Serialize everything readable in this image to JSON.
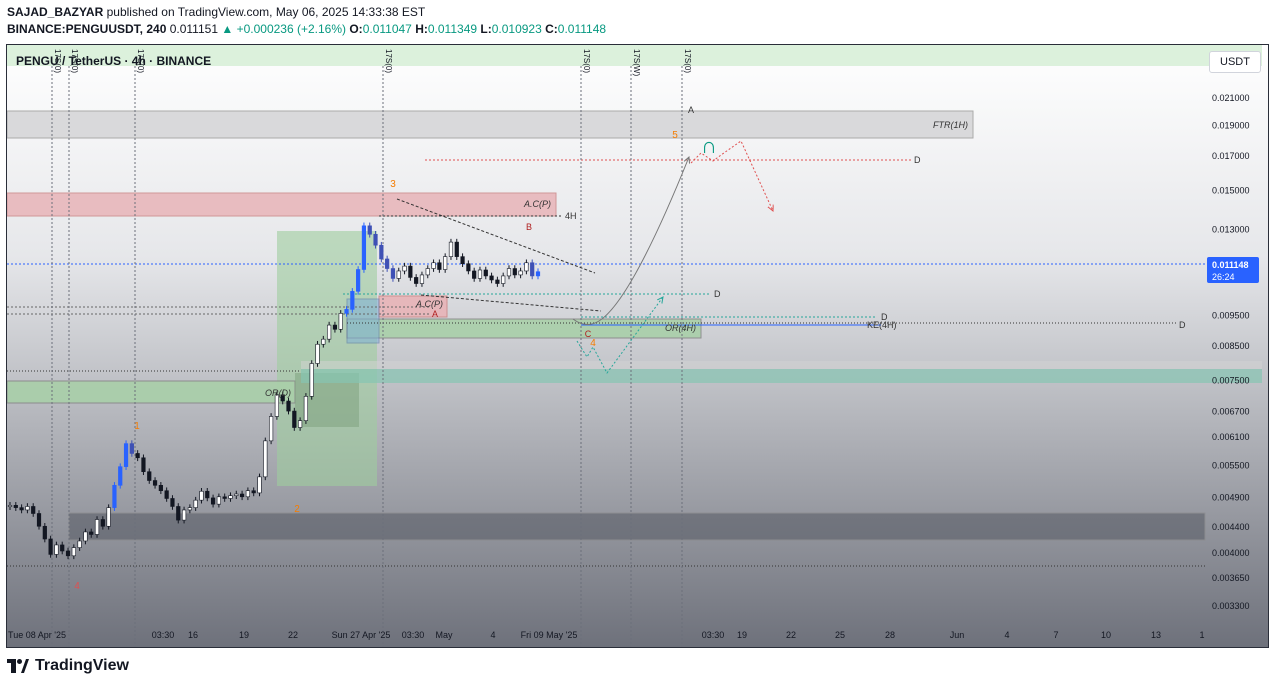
{
  "header": {
    "author": "SAJAD_BAZYAR",
    "published": "published on TradingView.com, May 06, 2025 14:33:38 EST",
    "symbol": "BINANCE:PENGUUSDT, 240",
    "last": "0.011151",
    "change": "+0.000236 (+2.16%)",
    "o_label": "O:",
    "o": "0.011047",
    "h_label": "H:",
    "h": "0.011349",
    "l_label": "L:",
    "l": "0.010923",
    "c_label": "C:",
    "c": "0.011148"
  },
  "legend_title": "PENGU / TetherUS · 4h · BINANCE",
  "currency_button": "USDT",
  "price_label": {
    "value": "0.011148",
    "countdown": "26:24"
  },
  "footer": {
    "brand": "TradingView"
  },
  "colors": {
    "accent": "#2962ff",
    "up": "#089981",
    "wave": "#f57c00"
  },
  "chart_data": {
    "type": "candlestick",
    "yscale": "log",
    "ylim": [
      0.0031,
      0.023
    ],
    "y_ticks": [
      "0.021000",
      "0.019000",
      "0.017000",
      "0.015000",
      "0.013000",
      "0.011500",
      "0.009500",
      "0.008500",
      "0.007500",
      "0.006700",
      "0.006100",
      "0.005500",
      "0.004900",
      "0.004400",
      "0.004000",
      "0.003650",
      "0.003300"
    ],
    "x_ticks": [
      "Tue 08 Apr '25",
      "03:30",
      "16",
      "19",
      "22",
      "Sun 27 Apr '25",
      "03:30",
      "May",
      "4",
      "Fri 09 May '25",
      "03:30",
      "19",
      "22",
      "25",
      "28",
      "Jun",
      "4",
      "7",
      "10",
      "13",
      "1"
    ],
    "vertical_labels": [
      "17S(0)",
      "17S(0)",
      "17S(0)",
      "17S(0)",
      "17S(0)",
      "17S(W)",
      "17S(0)"
    ],
    "zone_labels": [
      "FTR(1H)",
      "A.C(P)",
      "A.C(P)",
      "OR(4H)",
      "OR(D)",
      "KE(4H)"
    ],
    "level_labels": [
      "4H",
      "D",
      "D",
      "D",
      "D"
    ],
    "wave_labels": [
      "1",
      "2",
      "3",
      "4",
      "5",
      "4"
    ],
    "letter_labels": [
      "A",
      "B",
      "C",
      "A"
    ],
    "closes": [
      0.00476,
      0.00472,
      0.00468,
      0.00474,
      0.00462,
      0.00441,
      0.00421,
      0.00398,
      0.00412,
      0.00403,
      0.00396,
      0.00408,
      0.00418,
      0.00432,
      0.00428,
      0.00452,
      0.00441,
      0.00472,
      0.00512,
      0.00548,
      0.00596,
      0.00575,
      0.00566,
      0.00538,
      0.00521,
      0.00512,
      0.00502,
      0.00488,
      0.00474,
      0.00451,
      0.00468,
      0.00472,
      0.00485,
      0.00501,
      0.00489,
      0.00478,
      0.00491,
      0.00488,
      0.00493,
      0.00496,
      0.00491,
      0.00502,
      0.00498,
      0.00528,
      0.00602,
      0.00658,
      0.00712,
      0.00696,
      0.00671,
      0.00632,
      0.00648,
      0.00708,
      0.00798,
      0.00856,
      0.00872,
      0.00918,
      0.00904,
      0.00958,
      0.00972,
      0.01038,
      0.01124,
      0.01318,
      0.01278,
      0.01228,
      0.01168,
      0.01128,
      0.01088,
      0.01118,
      0.01138,
      0.01092,
      0.01068,
      0.01102,
      0.01128,
      0.01152,
      0.01124,
      0.01178,
      0.01242,
      0.01178,
      0.01148,
      0.01118,
      0.01088,
      0.01122,
      0.01098,
      0.01082,
      0.01068,
      0.01098,
      0.01128,
      0.01102,
      0.01118,
      0.01152,
      0.01098,
      0.01115
    ]
  }
}
